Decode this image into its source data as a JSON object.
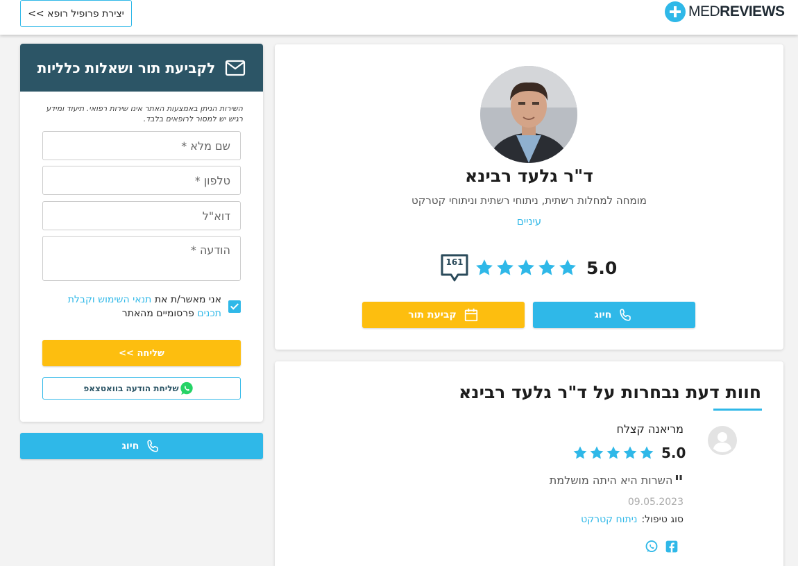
{
  "header": {
    "create_profile_label": "יצירת פרופיל רופא >>",
    "logo_light": "MED",
    "logo_bold": "REVIEWS"
  },
  "profile": {
    "doctor_name": "ד\"ר גלעד רבינא",
    "specialty": "מומחה למחלות רשתית, ניתוחי רשתית וניתוחי קטרקט",
    "field": "עיניים",
    "review_count": "161",
    "rating_value": "5.0",
    "rating_stars": 5,
    "call_label": "חיוג",
    "appointment_label": "קביעת תור"
  },
  "reviews": {
    "title": "חוות דעת נבחרות על ד\"ר גלעד רבינא",
    "items": [
      {
        "name": "מריאנה קצלח",
        "rating": "5.0",
        "stars": 5,
        "quote": "השרות היא היתה מושלמת",
        "date": "09.05.2023",
        "type_label": "סוג טיפול:",
        "type_value": "ניתוח קטרקט"
      }
    ]
  },
  "contact": {
    "title": "לקביעת תור ושאלות כלליות",
    "disclaimer": "השירות הניתן באמצעות האתר אינו שירות רפואי. תיעוד ומידע רגיש יש למסור לרופאים בלבד.",
    "name_placeholder": "שם מלא *",
    "phone_placeholder": "טלפון *",
    "email_placeholder": "דוא\"ל",
    "message_placeholder": "הודעה *",
    "consent_prefix": "אני מאשר/ת את",
    "consent_link1": "תנאי השימוש וקבלת תכנים",
    "consent_suffix": "פרסומיים מהאתר",
    "send_label": "שליחה >>",
    "whatsapp_label": "שליחת הודעה בוואטצאפ",
    "call_label": "חיוג"
  },
  "colors": {
    "brand_blue": "#2fb8e8",
    "brand_yellow": "#fdbe0f",
    "contact_header": "#2c5566"
  }
}
